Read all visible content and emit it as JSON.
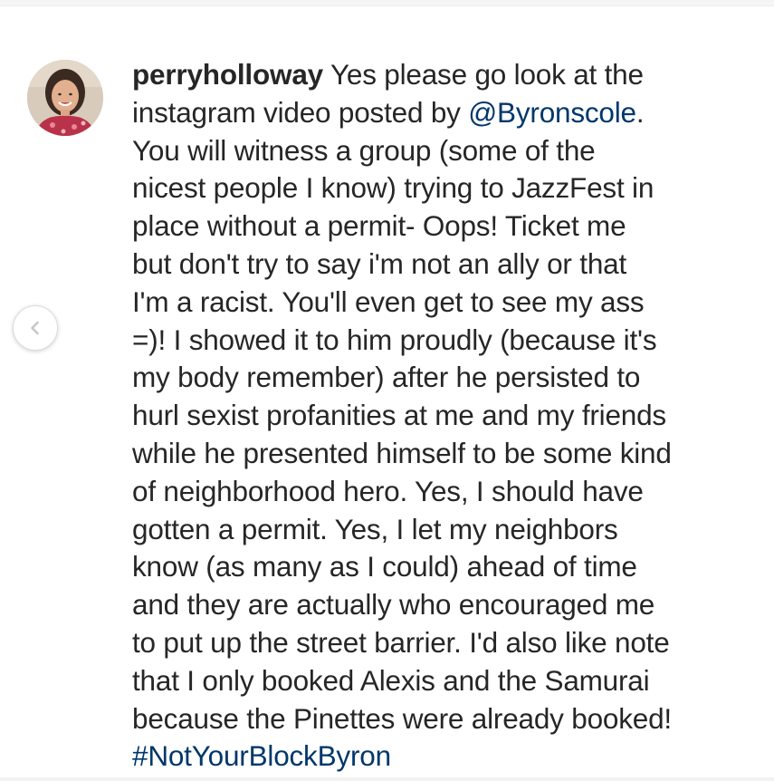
{
  "comment": {
    "username": "perryholloway",
    "lines": [
      "Yes please go look at the",
      "instagram video posted by ",
      "You will witness a group (some of the",
      "nicest people I know) trying to JazzFest in",
      "place without a permit- Oops! Ticket me",
      "but don't try to say i'm not an ally or that",
      "I'm a racist. You'll even get to see my ass",
      "=)! I showed it to him proudly (because it's",
      "my body remember) after he persisted to",
      "hurl sexist profanities at me and my friends",
      "while he presented himself to be some kind",
      "of neighborhood hero. Yes, I should have",
      "gotten a permit. Yes, I let my neighbors",
      "know (as many as I could) ahead of time",
      "and they are actually who encouraged me",
      "to put up the street barrier.  I'd also like note",
      "that I only booked Alexis and the Samurai",
      "because the Pinettes were already booked!"
    ],
    "mention": "@Byronscole",
    "mention_suffix": ".",
    "hashtag": "#NotYourBlockByron"
  },
  "icons": {
    "prev": "chevron-left-icon",
    "avatar": "profile-photo"
  },
  "colors": {
    "text": "#262626",
    "link": "#00376b",
    "background": "#ffffff"
  }
}
